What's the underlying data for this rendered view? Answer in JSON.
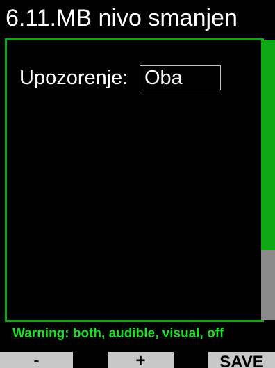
{
  "header": {
    "title": "6.11.MB nivo smanjen"
  },
  "setting": {
    "label": "Upozorenje:",
    "value": "Oba"
  },
  "scrollbar": {
    "position_fraction": 0.75
  },
  "hint": {
    "text": "Warning: both, audible, visual, off"
  },
  "softkeys": {
    "minus": "-",
    "plus": "+",
    "save": "SAVE"
  },
  "colors": {
    "accent": "#0ea814",
    "hint": "#1adf24",
    "softkey_bg": "#c8c8c8",
    "scroll_rest": "#8a8a8a"
  }
}
